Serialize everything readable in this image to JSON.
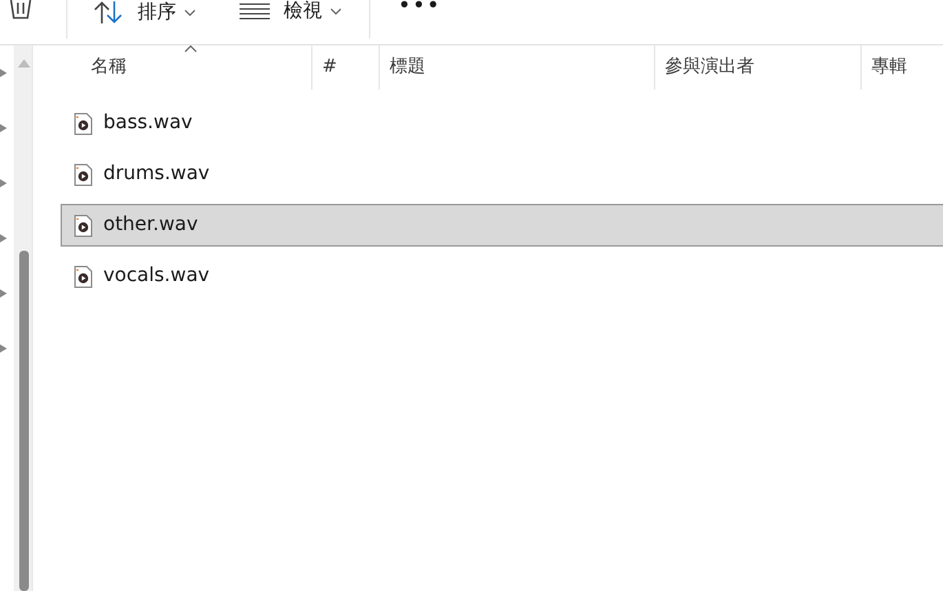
{
  "toolbar": {
    "sort_label": "排序",
    "view_label": "檢視",
    "more": "•••"
  },
  "nav_tree": {
    "items": [
      {
        "expanded": false
      },
      {
        "expanded": false
      },
      {
        "expanded": false
      },
      {
        "expanded": false
      },
      {
        "expanded": false
      },
      {
        "expanded": false
      }
    ]
  },
  "columns": [
    {
      "label": "名稱",
      "sorted": true
    },
    {
      "label": "#",
      "sorted": false
    },
    {
      "label": "標題",
      "sorted": false
    },
    {
      "label": "參與演出者",
      "sorted": false
    },
    {
      "label": "專輯",
      "sorted": false
    }
  ],
  "files": [
    {
      "name": "bass.wav",
      "selected": false
    },
    {
      "name": "drums.wav",
      "selected": false
    },
    {
      "name": "other.wav",
      "selected": true
    },
    {
      "name": "vocals.wav",
      "selected": false
    }
  ]
}
